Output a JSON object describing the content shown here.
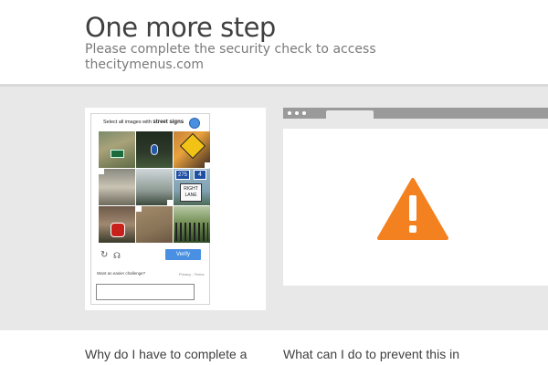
{
  "header": {
    "title": "One more step",
    "subtitle": "Please complete the security check to access thecitymenus.com"
  },
  "captcha": {
    "instruction_prefix": "Select all images with",
    "instruction_target": "street signs",
    "tile_sign_text": {
      "route_left": "275",
      "route_right": "4",
      "lane_sign": "RIGHT LANE"
    },
    "verify_label": "Verify",
    "easier_challenge": "Want an easier challenge?",
    "privacy_terms": "Privacy - Terms",
    "reload_icon": "reload-icon",
    "audio_icon": "headphones-icon",
    "answer_value": ""
  },
  "browser_illustration": {
    "icon": "warning-triangle-icon",
    "warning_color": "#f48120"
  },
  "faq": {
    "question_1": "Why do I have to complete a CAPTCHA?",
    "question_2": "What can I do to prevent this in the future?"
  },
  "colors": {
    "accent": "#4a90e2",
    "warning": "#f48120",
    "band": "#e8e8e8"
  }
}
